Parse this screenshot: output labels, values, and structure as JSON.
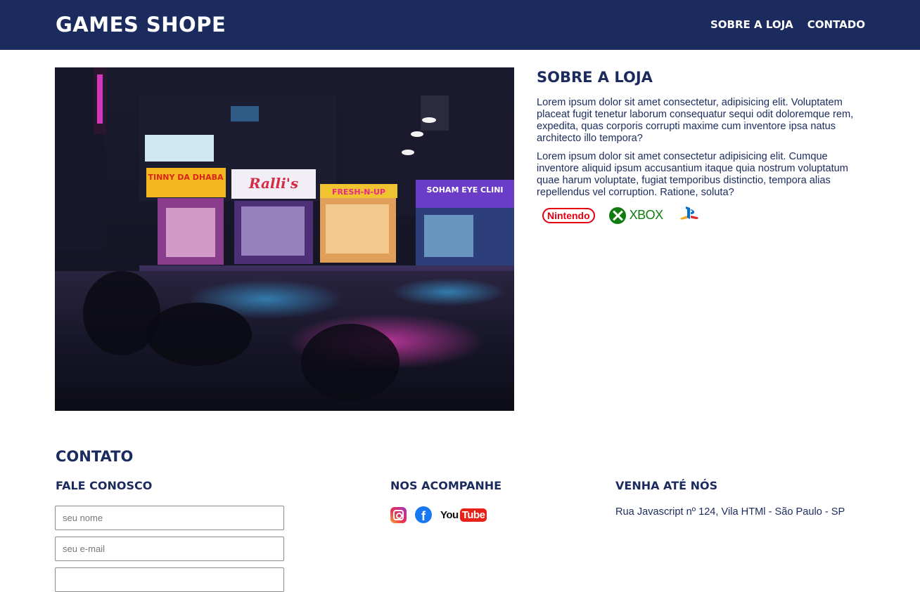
{
  "header": {
    "logo": "GAMES SHOPE",
    "nav": [
      "SOBRE A LOJA",
      "CONTADO"
    ]
  },
  "about": {
    "title": "SOBRE A LOJA",
    "paragraphs": [
      "Lorem ipsum dolor sit amet consectetur, adipisicing elit. Voluptatem placeat fugit tenetur laborum consequatur sequi odit doloremque rem, expedita, quas corporis corrupti maxime cum inventore ipsa natus architecto illo tempora?",
      "Lorem ipsum dolor sit amet consectetur adipisicing elit. Cumque inventore aliquid ipsum accusantium itaque quia nostrum voluptatum quae harum voluptate, fugiat temporibus distinctio, tempora alias repellendus vel corruption. Ratione, soluta?"
    ],
    "brands": {
      "nintendo": "Nintendo",
      "xbox": "XBOX",
      "playstation_icon": "playstation-icon"
    }
  },
  "hero_image": {
    "signs": [
      "TINNY DA DHABA",
      "Ralli's",
      "FRESH-N-UP",
      "SOHAM EYE CLINI"
    ]
  },
  "contact": {
    "title": "CONTATO",
    "form": {
      "title": "FALE CONOSCO",
      "name_placeholder": "seu nome",
      "email_placeholder": "seu e-mail"
    },
    "social": {
      "title": "NOS ACOMPANHE",
      "facebook_glyph": "f",
      "youtube_you": "You",
      "youtube_tube": "Tube",
      "icons": [
        "instagram-icon",
        "facebook-icon",
        "youtube-icon"
      ]
    },
    "visit": {
      "title": "VENHA ATÉ NÓS",
      "address": "Rua Javascript nº 124, Vila HTMl - São Paulo - SP"
    }
  },
  "colors": {
    "primary": "#1b2b5e",
    "white": "#ffffff",
    "nintendo_red": "#e4000f",
    "xbox_green": "#107c10",
    "youtube_red": "#e62117",
    "facebook_blue": "#1877f2"
  }
}
